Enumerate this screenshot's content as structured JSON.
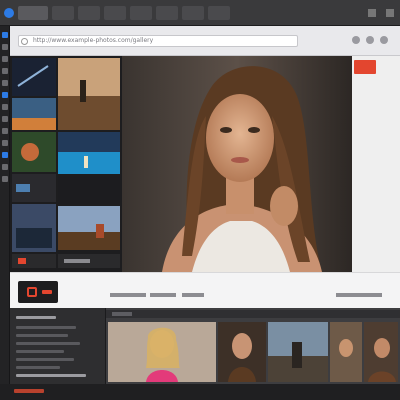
{
  "window": {
    "tabs": [
      "",
      "",
      "",
      "",
      "",
      ""
    ],
    "address": "http://www.example-photos.com/gallery"
  },
  "hero": {
    "cta_label": "",
    "accent_color": "#e3462f"
  },
  "bottombar": {
    "labels": [
      "",
      "",
      "",
      ""
    ]
  },
  "colors": {
    "accent_blue": "#2d7be5",
    "accent_red": "#e3462f",
    "panel": "#2e2e30"
  }
}
